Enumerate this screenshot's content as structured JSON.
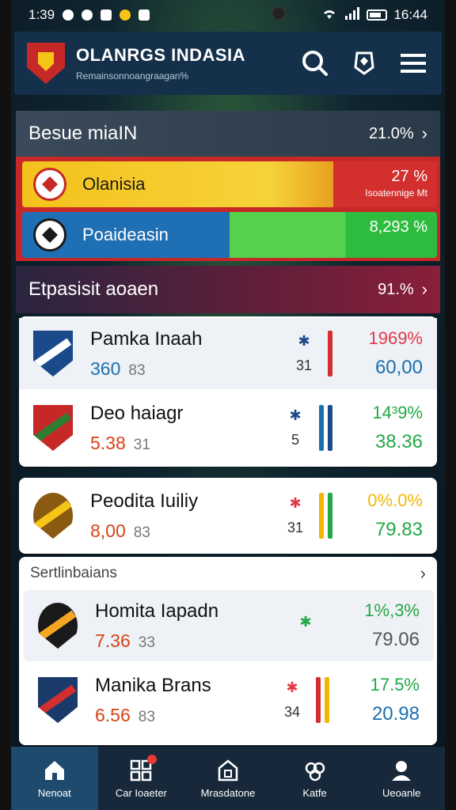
{
  "status": {
    "time": "1:39",
    "clock": "16:44"
  },
  "header": {
    "title": "OLANRGS INDASIA",
    "subtitle": "Remainsonnoangraagan%"
  },
  "section1": {
    "title": "Besue miaIN",
    "value": "21.0%"
  },
  "top_bars": [
    {
      "team": "Olanisia",
      "pct": "27 %",
      "sub": "Isoatennige Mt",
      "left_color": "#f4c21c",
      "right_color": "#d32f2f"
    },
    {
      "team": "Poaideasin",
      "pct": "8,293 %",
      "sub": "",
      "left_color": "#1f6fb5",
      "right_color": "#2ebc3f"
    }
  ],
  "section2": {
    "title": "Etpasisit aoaen",
    "value": "91.%"
  },
  "teams": [
    {
      "name": "Pamka Inaah",
      "score": "360",
      "score_sub": "83",
      "mid_num": "31",
      "pct1": "1969%",
      "pct2": "60,00",
      "score_color": "#1a6fb0",
      "p1_color": "#e0394a",
      "p2_color": "#1a6fb0",
      "arrow_color": "#1a4a8a"
    },
    {
      "name": "Deo haiagr",
      "score": "5.38",
      "score_sub": "31",
      "mid_num": "5",
      "pct1": "14³9%",
      "pct2": "38.36",
      "score_color": "#d84315",
      "p1_color": "#22a845",
      "p2_color": "#22a845",
      "arrow_color": "#1a4a8a"
    },
    {
      "name": "Peodita Iuiliy",
      "score": "8,00",
      "score_sub": "83",
      "mid_num": "31",
      "pct1": "0%.0%",
      "pct2": "79.83",
      "score_color": "#d84315",
      "p1_color": "#f2b705",
      "p2_color": "#22a845",
      "arrow_color": "#e0394a"
    },
    {
      "name": "Homita Iapadn",
      "score": "7.36",
      "score_sub": "33",
      "mid_num": "",
      "pct1": "1%,3%",
      "pct2": "79.06",
      "score_color": "#d84315",
      "p1_color": "#22a845",
      "p2_color": "#555555",
      "arrow_color": "#22a845"
    },
    {
      "name": "Manika Brans",
      "score": "6.56",
      "score_sub": "83",
      "mid_num": "34",
      "pct1": "17.5%",
      "pct2": "20.98",
      "score_color": "#d84315",
      "p1_color": "#22a845",
      "p2_color": "#1a6fb0",
      "arrow_color": "#e0394a"
    }
  ],
  "sublabel": "Sertlinbaians",
  "nav": [
    {
      "label": "Nenoat",
      "icon": "home-icon"
    },
    {
      "label": "Car Ioaeter",
      "icon": "dashboard-icon"
    },
    {
      "label": "Mrasdatone",
      "icon": "building-icon"
    },
    {
      "label": "Katfe",
      "icon": "gift-icon"
    },
    {
      "label": "Ueoanle",
      "icon": "profile-icon"
    }
  ]
}
